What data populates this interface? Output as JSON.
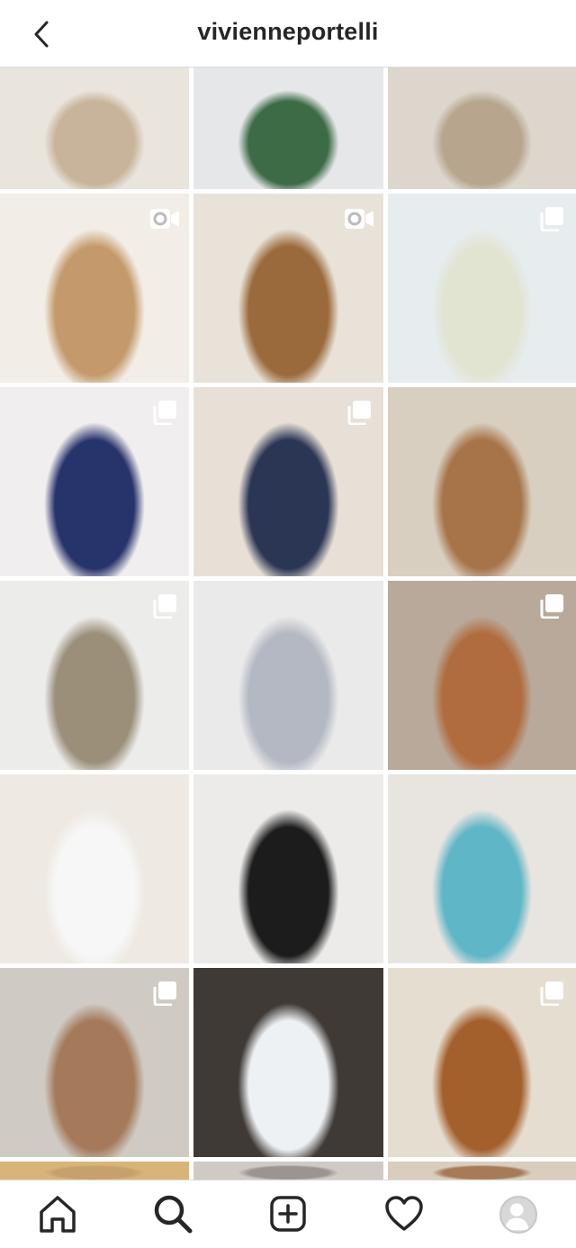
{
  "header": {
    "username": "vivienneportelli",
    "back_icon": "chevron-left-icon"
  },
  "grid": {
    "tiles": [
      {
        "name": "post-cream-cardigan",
        "badge": "none",
        "colors": [
          "#e9e4dc",
          "#c8b49a"
        ]
      },
      {
        "name": "post-green-hoodie",
        "badge": "none",
        "colors": [
          "#e6e7e9",
          "#3c6b45"
        ]
      },
      {
        "name": "post-cream-cardigan-street",
        "badge": "none",
        "colors": [
          "#dcd6cc",
          "#b7a58d"
        ]
      },
      {
        "name": "post-tan-sweater-white-shirt",
        "badge": "video",
        "colors": [
          "#f2ede6",
          "#c49a6c"
        ]
      },
      {
        "name": "post-brown-knit-balcony",
        "badge": "video",
        "colors": [
          "#e8e2d8",
          "#9b6a3c"
        ]
      },
      {
        "name": "post-knit-vest-white-shirt",
        "badge": "carousel",
        "colors": [
          "#e7ecee",
          "#e2e4d2"
        ]
      },
      {
        "name": "post-navy-sweater-bioderma",
        "badge": "carousel",
        "colors": [
          "#f0eeee",
          "#27336b"
        ]
      },
      {
        "name": "post-navy-blazer-jeans",
        "badge": "carousel",
        "colors": [
          "#e8e0d6",
          "#2b3655"
        ]
      },
      {
        "name": "post-brown-sweater-stairs",
        "badge": "none",
        "colors": [
          "#d8cfc0",
          "#a7744a"
        ]
      },
      {
        "name": "post-vest-snake-pants",
        "badge": "carousel",
        "colors": [
          "#ececea",
          "#9b8f7a"
        ]
      },
      {
        "name": "post-grey-hoodie-bag",
        "badge": "none",
        "colors": [
          "#eaeaea",
          "#b4b8c2"
        ]
      },
      {
        "name": "post-beige-sweater-steps",
        "badge": "carousel",
        "colors": [
          "#b9a99a",
          "#b06c3e"
        ]
      },
      {
        "name": "post-white-robe-coffee",
        "badge": "none",
        "colors": [
          "#eeeae3",
          "#f7f7f7"
        ]
      },
      {
        "name": "post-black-blazer-dress",
        "badge": "none",
        "colors": [
          "#ecebe9",
          "#1c1c1c"
        ]
      },
      {
        "name": "post-blue-socks-flatlay",
        "badge": "none",
        "colors": [
          "#e8e4e0",
          "#5fb6c7"
        ]
      },
      {
        "name": "post-camel-coat-beanie",
        "badge": "carousel",
        "colors": [
          "#cfcbc4",
          "#a47a5a"
        ]
      },
      {
        "name": "post-couple-white-robes",
        "badge": "none",
        "colors": [
          "#3f3a36",
          "#eef1f4"
        ]
      },
      {
        "name": "post-brown-knit-black-bag",
        "badge": "carousel",
        "colors": [
          "#e5ddd0",
          "#a35f2c"
        ]
      },
      {
        "name": "post-partial-1",
        "badge": "none",
        "colors": [
          "#d8b478",
          "#c8a06a"
        ]
      },
      {
        "name": "post-partial-2",
        "badge": "none",
        "colors": [
          "#cfcac4",
          "#9a9590"
        ]
      },
      {
        "name": "post-partial-3",
        "badge": "none",
        "colors": [
          "#d9cdbd",
          "#a77b58"
        ]
      }
    ]
  },
  "bottom_nav": {
    "items": [
      "home-icon",
      "search-icon",
      "new-post-icon",
      "activity-heart-icon",
      "profile-avatar"
    ]
  }
}
